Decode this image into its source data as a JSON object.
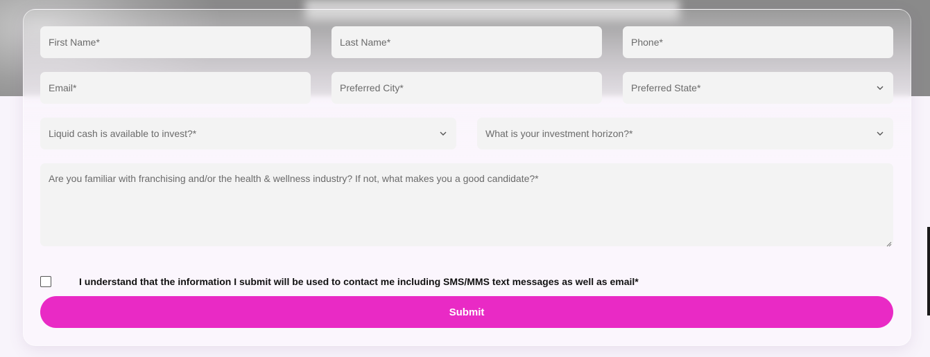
{
  "form": {
    "first_name": {
      "placeholder": "First Name*"
    },
    "last_name": {
      "placeholder": "Last Name*"
    },
    "phone": {
      "placeholder": "Phone*"
    },
    "email": {
      "placeholder": "Email*"
    },
    "preferred_city": {
      "placeholder": "Preferred City*"
    },
    "preferred_state": {
      "placeholder": "Preferred State*"
    },
    "liquid_cash": {
      "placeholder": "Liquid cash is available to invest?*"
    },
    "investment_horizon": {
      "placeholder": "What is your investment horizon?*"
    },
    "familiarity": {
      "placeholder": "Are you familiar with franchising and/or the health & wellness industry? If not, what makes you a good candidate?*"
    },
    "consent_label": "I understand that the information I submit will be used to contact me including SMS/MMS text messages as well as email*",
    "consent_checked": false,
    "submit_label": "Submit"
  },
  "colors": {
    "accent": "#e92ac5",
    "field_bg": "#f3f3f3",
    "placeholder_text": "#6a6a6a"
  },
  "icons": {
    "select_chevron": "chevron-down-icon",
    "textarea_resize": "resize-grip-icon"
  }
}
